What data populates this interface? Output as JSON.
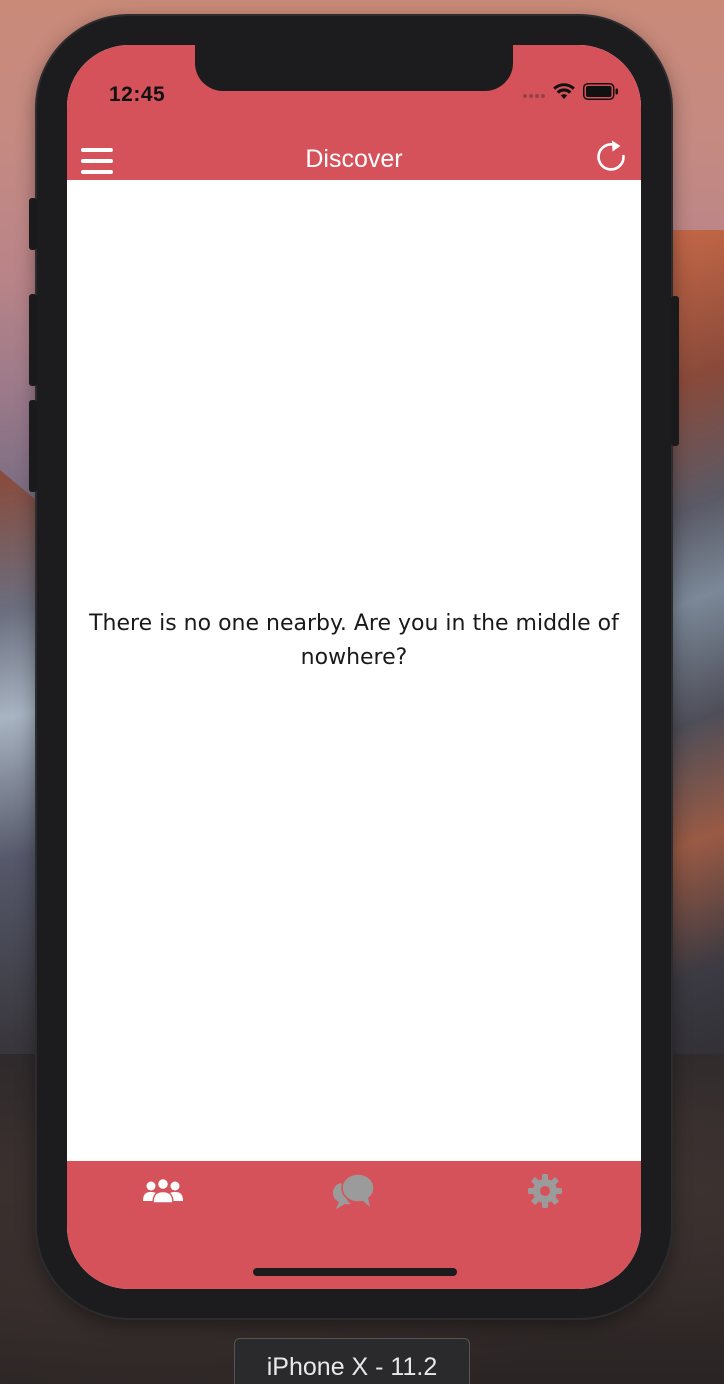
{
  "status_bar": {
    "time": "12:45"
  },
  "nav": {
    "title": "Discover",
    "menu_icon": "hamburger-menu-icon",
    "refresh_icon": "refresh-icon"
  },
  "content": {
    "empty_message": "There is no one nearby. Are you in the middle of nowhere?"
  },
  "tabs": [
    {
      "name": "people",
      "icon": "people-icon",
      "active": true
    },
    {
      "name": "chat",
      "icon": "chat-bubbles-icon",
      "active": false
    },
    {
      "name": "settings",
      "icon": "gear-icon",
      "active": false
    }
  ],
  "simulator": {
    "device_label": "iPhone X - 11.2"
  },
  "colors": {
    "accent": "#d5525a",
    "tab_active": "#ffffff",
    "tab_inactive": "#9b9b9b",
    "text": "#1a1a1a"
  }
}
